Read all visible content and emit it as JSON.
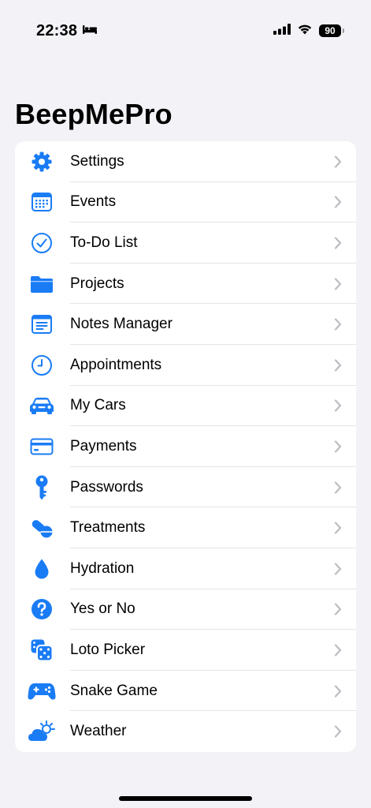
{
  "status_bar": {
    "time": "22:38",
    "battery": "90",
    "sleep_icon": "bed-icon",
    "signal_icon": "cellular-signal-icon",
    "wifi_icon": "wifi-icon"
  },
  "page": {
    "title": "BeepMePro"
  },
  "accent_color": "#1A7CF5",
  "menu": {
    "items": [
      {
        "label": "Settings",
        "icon": "gear-icon"
      },
      {
        "label": "Events",
        "icon": "calendar-icon"
      },
      {
        "label": "To-Do List",
        "icon": "checkmark-circle-icon"
      },
      {
        "label": "Projects",
        "icon": "folder-icon"
      },
      {
        "label": "Notes Manager",
        "icon": "notes-icon"
      },
      {
        "label": "Appointments",
        "icon": "clock-icon"
      },
      {
        "label": "My Cars",
        "icon": "car-icon"
      },
      {
        "label": "Payments",
        "icon": "credit-card-icon"
      },
      {
        "label": "Passwords",
        "icon": "key-icon"
      },
      {
        "label": "Treatments",
        "icon": "pills-icon"
      },
      {
        "label": "Hydration",
        "icon": "water-drop-icon"
      },
      {
        "label": "Yes or No",
        "icon": "question-circle-icon"
      },
      {
        "label": "Loto Picker",
        "icon": "dice-icon"
      },
      {
        "label": "Snake Game",
        "icon": "gamecontroller-icon"
      },
      {
        "label": "Weather",
        "icon": "cloud-sun-icon"
      }
    ]
  }
}
